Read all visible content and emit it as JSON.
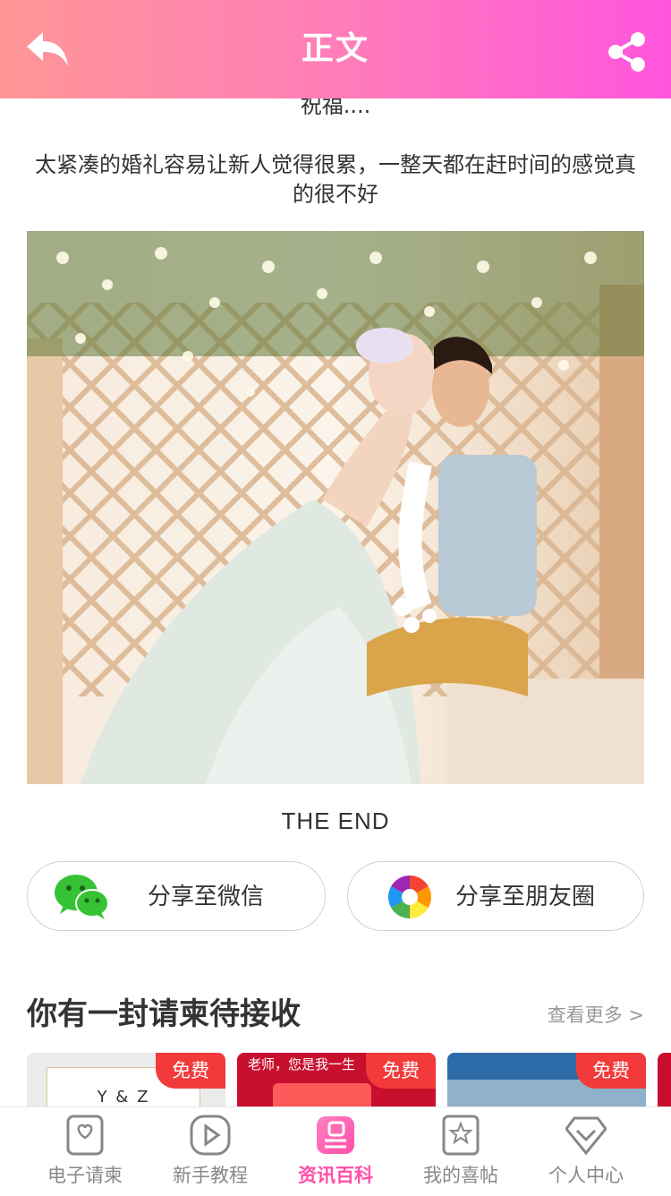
{
  "header": {
    "title": "正文"
  },
  "article": {
    "cut_line": "祝福....",
    "paragraph": "太紧凑的婚礼容易让新人觉得很累，一整天都在赶时间的感觉真的很不好",
    "end_text": "THE END"
  },
  "share": {
    "wechat_label": "分享至微信",
    "moments_label": "分享至朋友圈"
  },
  "invites": {
    "title": "你有一封请柬待接收",
    "more_label": "查看更多 >",
    "cards": [
      {
        "badge": "免费",
        "text": "Y & Z"
      },
      {
        "badge": "免费",
        "text": "老师，您是我一生"
      },
      {
        "badge": "免费"
      }
    ]
  },
  "tabs": [
    {
      "label": "电子请柬",
      "icon": "heart-card-icon"
    },
    {
      "label": "新手教程",
      "icon": "play-icon"
    },
    {
      "label": "资讯百科",
      "icon": "news-icon",
      "active": true
    },
    {
      "label": "我的喜帖",
      "icon": "star-card-icon"
    },
    {
      "label": "个人中心",
      "icon": "diamond-icon"
    }
  ],
  "colors": {
    "header_start": "#ff9696",
    "header_end": "#ff55de",
    "badge": "#f23a3a",
    "active_tab": "#ff4fa8"
  }
}
